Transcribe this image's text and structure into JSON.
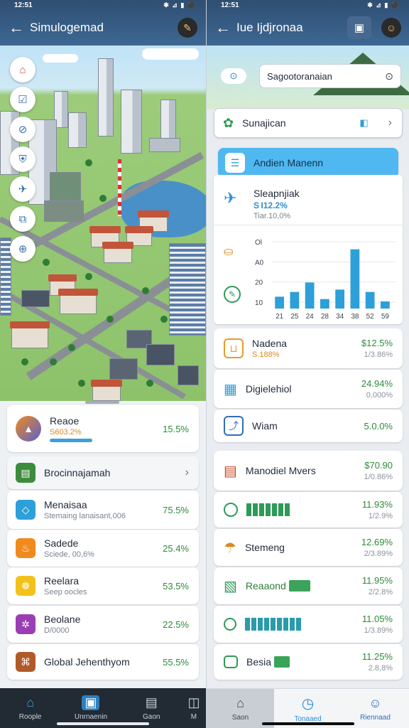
{
  "left": {
    "status": {
      "time": "12:51",
      "icons": "✱ ⊿ ▮ ⚫"
    },
    "header": {
      "title": "Simulogemad",
      "back": "←",
      "action_icon": "✎"
    },
    "map_tools": [
      "⌂",
      "☑",
      "⊘",
      "⛨",
      "✈",
      "⧉",
      "⊕"
    ],
    "cards": [
      {
        "id": "reaoe",
        "title": "Reaoe",
        "subtitle": "S603.2%",
        "value": "15.5%",
        "color": "#5a5fd1"
      },
      {
        "id": "brochure",
        "title": "Brocinnajamah",
        "color": "#3d8b3d"
      },
      {
        "id": "menaisa",
        "title": "Menaisaa",
        "subtitle": "Stemaing lanaisant,006",
        "value": "75.5%",
        "color": "#2d9fd9"
      },
      {
        "id": "sodede",
        "title": "Sadede",
        "subtitle": "Sciede, 00,6%",
        "value": "25.4%",
        "color": "#f08a1c"
      },
      {
        "id": "reelara",
        "title": "Reelara",
        "subtitle": "Seep oocles",
        "value": "53.5%",
        "color": "#f2c21a"
      },
      {
        "id": "beolane",
        "title": "Beolane",
        "subtitle": "D/0000",
        "value": "22.5%",
        "color": "#9a3fb3"
      },
      {
        "id": "global",
        "title": "Global Jehenthyom",
        "value": "55.5%",
        "color": "#b05a2a"
      }
    ],
    "nav": [
      {
        "label": "Roople",
        "icon": "⌂"
      },
      {
        "label": "Unrnaenin",
        "icon": "▣"
      },
      {
        "label": "Gaon",
        "icon": "▤"
      },
      {
        "label": "M",
        "icon": "◫"
      }
    ]
  },
  "right": {
    "status": {
      "time": "12:51",
      "icons": "✱ ⊿ ▮ ⚫"
    },
    "header": {
      "title": "Iue Ijdjronaa",
      "back": "←",
      "action_icon": "▣"
    },
    "search": {
      "left_icon": "⊙",
      "value": "Sagootoranaian",
      "right_icon": "⊙"
    },
    "section": {
      "title": "Sunajican",
      "icon": "◧"
    },
    "highlight": {
      "title": "Andien Manenn",
      "icon": "☰"
    },
    "chart_card": {
      "title": "Sleapnjiak",
      "line2": "S I12.2%",
      "line3": "Tiar.10,0%"
    },
    "chart_data": {
      "type": "bar",
      "y_ticks_printed": [
        "Ol",
        "A0",
        "20",
        "10"
      ],
      "ylabel": "",
      "categories": [
        "21",
        "25",
        "24",
        "28",
        "34",
        "38",
        "52",
        "59"
      ],
      "values": [
        10,
        14,
        22,
        8,
        16,
        50,
        14,
        6
      ],
      "ylim": [
        0,
        60
      ]
    },
    "cards": [
      {
        "id": "nadena",
        "title": "Nadena",
        "subtitle": "S.188%",
        "value": "$12.5%",
        "sub": "1/3.86%",
        "color": "#e69b2a"
      },
      {
        "id": "digital",
        "title": "Digielehiol",
        "value": "24.94%",
        "sub": "0,000%",
        "color": "#2d9fd9"
      },
      {
        "id": "wiam",
        "title": "Wiam",
        "value": "5.0.0%",
        "color": "#2d6fb9"
      },
      {
        "id": "manodel",
        "title": "Manodiel Mvers",
        "value": "$70.90",
        "sub": "1/0.86%",
        "color": "#c24a2a"
      },
      {
        "id": "minibars1",
        "value": "11.93%",
        "sub": "1/2.9%",
        "color": "#2e9a58"
      },
      {
        "id": "stemaing",
        "title": "Stemeng",
        "value": "12.69%",
        "sub": "2/3.89%",
        "color": "#d98a1c"
      },
      {
        "id": "reaaond",
        "title": "Reaaond",
        "value": "11.95%",
        "sub": "2/2.8%",
        "color": "#2e9a58"
      },
      {
        "id": "minibars2",
        "value": "11.05%",
        "sub": "1/3.89%",
        "color": "#2e9a58"
      },
      {
        "id": "besia",
        "title": "Besia",
        "value": "11.25%",
        "sub": "2.8,8%",
        "color": "#2e9a58"
      }
    ],
    "nav": [
      {
        "label": "Saon",
        "icon": "⌂"
      },
      {
        "label": "Tonaaed",
        "icon": "◷"
      },
      {
        "label": "Riennaad",
        "icon": "☺"
      }
    ]
  }
}
